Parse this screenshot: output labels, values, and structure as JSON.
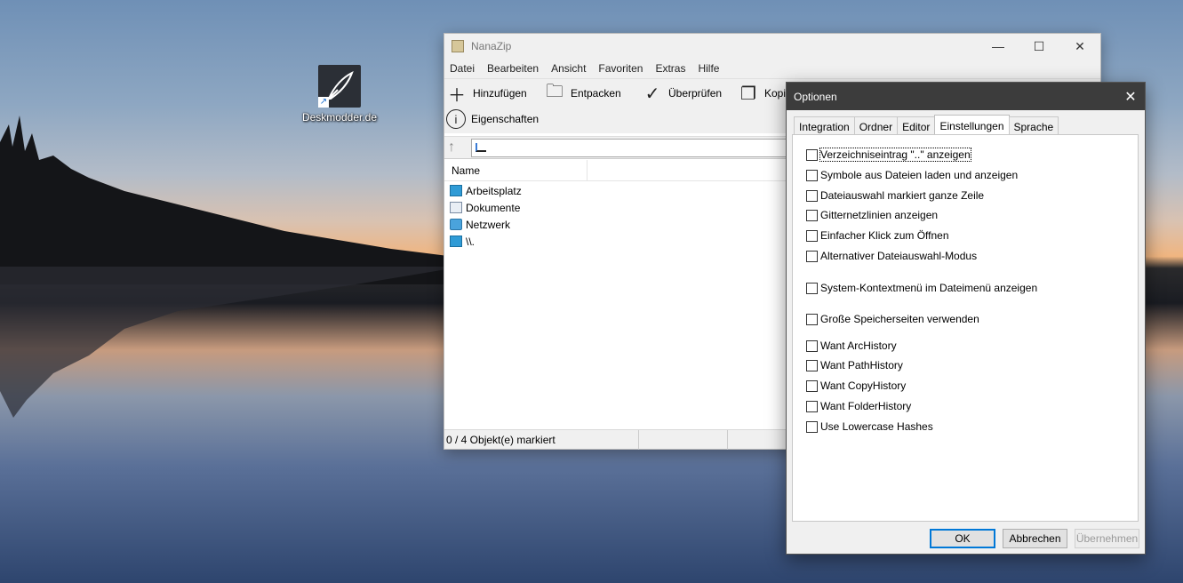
{
  "desktop": {
    "icon_label": "Deskmodder.de"
  },
  "nanazip": {
    "title": "NanaZip",
    "window_controls": {
      "minimize": "—",
      "maximize": "☐",
      "close": "✕"
    },
    "menu": [
      "Datei",
      "Bearbeiten",
      "Ansicht",
      "Favoriten",
      "Extras",
      "Hilfe"
    ],
    "toolbar": {
      "add": "Hinzufügen",
      "extract": "Entpacken",
      "test": "Überprüfen",
      "copy": "Kopie",
      "properties": "Eigenschaften"
    },
    "list_header": "Name",
    "items": [
      {
        "name": "Arbeitsplatz",
        "icon": "computer-icon"
      },
      {
        "name": "Dokumente",
        "icon": "document-icon"
      },
      {
        "name": "Netzwerk",
        "icon": "network-icon"
      },
      {
        "name": "\\\\.",
        "icon": "computer-icon"
      }
    ],
    "status": "0 / 4 Objekt(e) markiert"
  },
  "options": {
    "title": "Optionen",
    "close": "✕",
    "tabs": [
      "Integration",
      "Ordner",
      "Editor",
      "Einstellungen",
      "Sprache"
    ],
    "active_tab": "Einstellungen",
    "checkboxes": [
      "Verzeichniseintrag \"..\" anzeigen",
      "Symbole aus Dateien laden und anzeigen",
      "Dateiauswahl markiert ganze Zeile",
      "Gitternetzlinien anzeigen",
      "Einfacher Klick zum Öffnen",
      "Alternativer Dateiauswahl-Modus",
      "System-Kontextmenü im Dateimenü anzeigen",
      "Große Speicherseiten verwenden",
      "Want ArcHistory",
      "Want PathHistory",
      "Want CopyHistory",
      "Want FolderHistory",
      "Use Lowercase Hashes"
    ],
    "buttons": {
      "ok": "OK",
      "cancel": "Abbrechen",
      "apply": "Übernehmen"
    }
  }
}
